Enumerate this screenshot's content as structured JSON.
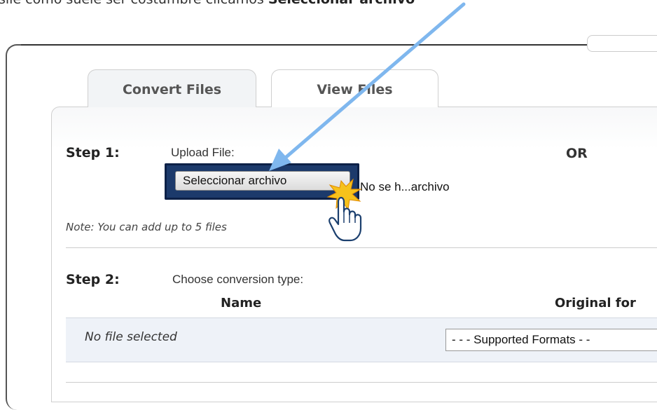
{
  "caption": {
    "prefix": "sile como suele ser costumbre clicamos ",
    "bold": "Seleccionar archivo"
  },
  "tabs": [
    {
      "label": "Convert Files",
      "active": true
    },
    {
      "label": "View Files",
      "active": false
    }
  ],
  "step1": {
    "label": "Step 1:",
    "upload_label": "Upload File:",
    "or_label": "OR",
    "file_button": "Seleccionar archivo",
    "file_status": "No se h...archivo",
    "note": "Note: You can add up to 5 files"
  },
  "step2": {
    "label": "Step 2:",
    "instruction": "Choose conversion type:",
    "columns": [
      "Name",
      "Original for"
    ],
    "row_placeholder": "No file selected",
    "format_select": "- - - Supported Formats - -"
  },
  "colors": {
    "arrow": "#7fb7ee",
    "highlight_border": "#1c3a6b",
    "row_bg": "#eef2f8"
  },
  "icons": [
    "pointer-hand-icon",
    "click-burst-icon",
    "annotation-arrow"
  ]
}
